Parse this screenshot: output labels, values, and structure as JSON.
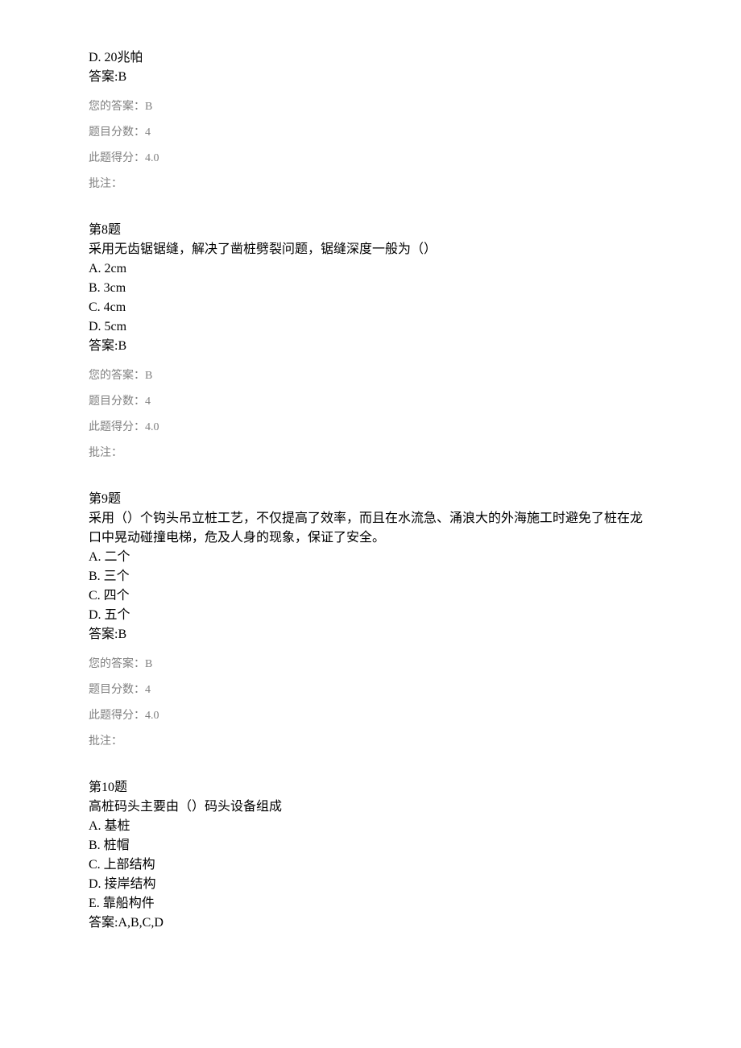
{
  "frag": {
    "opt_d": "D. 20兆帕",
    "answer": "答案:B",
    "your": "您的答案：B",
    "full": "题目分数：4",
    "earned": "此题得分：4.0",
    "note": "批注："
  },
  "q8": {
    "num": "第8题",
    "stem": "采用无齿锯锯缝，解决了凿桩劈裂问题，锯缝深度一般为（）",
    "a": "A. 2cm",
    "b": "B. 3cm",
    "c": "C. 4cm",
    "d": "D. 5cm",
    "answer": "答案:B",
    "your": "您的答案：B",
    "full": "题目分数：4",
    "earned": "此题得分：4.0",
    "note": "批注："
  },
  "q9": {
    "num": "第9题",
    "stem": "采用（）个钩头吊立桩工艺，不仅提高了效率，而且在水流急、涌浪大的外海施工时避免了桩在龙口中晃动碰撞电梯，危及人身的现象，保证了安全。",
    "a": "A. 二个",
    "b": "B. 三个",
    "c": "C. 四个",
    "d": "D. 五个",
    "answer": "答案:B",
    "your": "您的答案：B",
    "full": "题目分数：4",
    "earned": "此题得分：4.0",
    "note": "批注："
  },
  "q10": {
    "num": "第10题",
    "stem": "高桩码头主要由（）码头设备组成",
    "a": "A. 基桩",
    "b": "B. 桩帽",
    "c": "C. 上部结构",
    "d": "D. 接岸结构",
    "e": "E. 靠船构件",
    "answer": "答案:A,B,C,D"
  }
}
